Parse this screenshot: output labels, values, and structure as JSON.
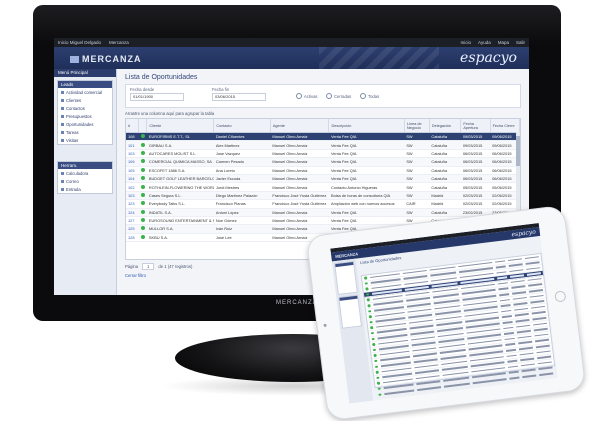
{
  "os_bar": {
    "left_items": [
      "Inicio Miguel Delgado",
      "Mercanza"
    ],
    "right_items": [
      "Inicio",
      "Ayuda",
      "Mapa",
      "Salir"
    ]
  },
  "app": {
    "logo_text": "MERCANZA",
    "brand": "espacyo"
  },
  "sidebar": {
    "header": "Menú Principal",
    "panel1": {
      "title": "Leads",
      "items": [
        "Actividad comercial",
        "Clientes",
        "Contactos",
        "Presupuestos",
        "Oportunidades",
        "Tareas",
        "Visitas"
      ]
    },
    "panel2": {
      "title": "Herram.",
      "items": [
        "Calculadora",
        "Correo",
        "Entrada"
      ]
    }
  },
  "page": {
    "title": "Lista de Oportunidades"
  },
  "filters": {
    "date_from_label": "Fecha desde",
    "date_from_value": "01/01/1900",
    "date_to_label": "Fecha fin",
    "date_to_value": "03/06/2015",
    "radio_options": [
      "Activas",
      "Cerradas",
      "Todas"
    ]
  },
  "grid": {
    "hint": "Arrastre una columna aquí para agrupar la tabla",
    "columns": [
      "#",
      "",
      "Cliente",
      "Contacto",
      "Agente",
      "Descripción",
      "Línea de Negocio",
      "Delegación",
      "Fecha Apertura",
      "Fecha Cierre"
    ],
    "rows": [
      [
        "108",
        "EUROFIRMS E.T.T., SL",
        "Daniel Cifuentes",
        "Manuel Olmo Arnaiz",
        "Venta Fee QIA",
        "SW",
        "Cataluña",
        "09/03/2015",
        "09/06/2015"
      ],
      [
        "101",
        "GIRBAU S.A.",
        "Alex Martinez",
        "Manuel Olmo Arnaiz",
        "Venta Fee QIA",
        "SW",
        "Cataluña",
        "09/03/2015",
        "09/06/2015"
      ],
      [
        "103",
        "AUTOCARES MOLIST S.L.",
        "Jose Vazquez",
        "Manuel Olmo Arnaiz",
        "Venta Fee QIA",
        "SW",
        "Cataluña",
        "06/03/2015",
        "06/06/2015"
      ],
      [
        "106",
        "COMERCIAL QUIMICA MASSO, SA",
        "Carmen Pesado",
        "Manuel Olmo Arnaiz",
        "Venta Fee QIA",
        "SW",
        "Cataluña",
        "06/03/2015",
        "06/06/2015"
      ],
      [
        "105",
        "ESCOFET 1886 S.A.",
        "Ana Loreto",
        "Manuel Olmo Arnaiz",
        "Venta Fee QIA",
        "SW",
        "Cataluña",
        "06/03/2015",
        "06/06/2015"
      ],
      [
        "104",
        "BUDGET GOLF LEATHER BARCELONA SA",
        "Javier Escoda",
        "Manuel Olmo Arnaiz",
        "Venta Fee QIA",
        "SW",
        "Cataluña",
        "06/03/2015",
        "06/06/2015"
      ],
      [
        "102",
        "ROTHLEIN-FLOWERING THE WORLD S.L.",
        "Jordi Mestres",
        "Manuel Olmo Arnaiz",
        "Contacto Antonio Higueras",
        "SW",
        "Cataluña",
        "05/03/2015",
        "05/06/2015"
      ],
      [
        "103",
        "Cases Segura S.L.",
        "Diego Martínez Palazón",
        "Francisco José Yusta Gutiérrez",
        "Bolsa de horas de consultoría QIA",
        "SW",
        "Madrid",
        "02/03/2015",
        "02/06/2015"
      ],
      [
        "123",
        "Everybody Talks S.L.",
        "Francisco Planas",
        "Francisco José Yusta Gutiérrez",
        "Ampliación web con nuevos accesos",
        "CAIR",
        "Madrid",
        "02/03/2015",
        "02/06/2015"
      ],
      [
        "124",
        "INDATIL S.A.",
        "Antoni López",
        "Manuel Olmo Arnaiz",
        "Venta Fee QIA",
        "SW",
        "Cataluña",
        "23/02/2015",
        "23/05/2015"
      ],
      [
        "127",
        "EUROSOUND ENTERTAINMENT & SERVICES S.L.",
        "Noe Gómez",
        "Manuel Olmo Arnaiz",
        "Venta Fee QIA",
        "SW",
        "Cataluña",
        "23/02/2015",
        "23/05/2015"
      ],
      [
        "125",
        "MULLOR S.A.",
        "Iván Ruiz",
        "Manuel Olmo Arnaiz",
        "Venta Fee QIA",
        "SW",
        "Cataluña",
        "27/02/2015",
        "27/05/2015"
      ],
      [
        "128",
        "SKBU S.A.",
        "José Lee",
        "Manuel Olmo Arnaiz",
        "Venta Fee QIA",
        "SW",
        "Cataluña",
        "28/02/2015",
        "28/05/2015"
      ]
    ]
  },
  "pager": {
    "label": "Página",
    "page": "1",
    "of_text": "de 1 (47 registros)"
  },
  "close_link": "Cerrar filtro",
  "tablet": {
    "logo_text": "MERCANZA",
    "brand": "espacyo",
    "title": "Lista de Oportunidades"
  },
  "monitor_brand": "MERCANZA"
}
